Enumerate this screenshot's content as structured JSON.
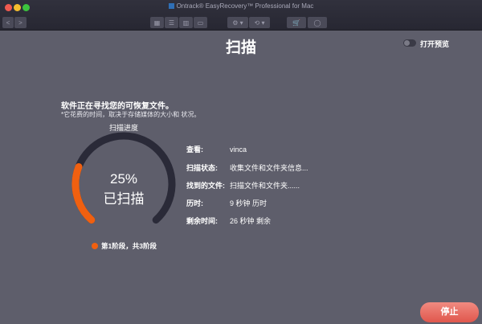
{
  "window": {
    "title": "Ontrack® EasyRecovery™ Professional for Mac"
  },
  "toolbar": {
    "back": "<",
    "forward": ">",
    "views": [
      "▦",
      "☰",
      "▥",
      "▭"
    ],
    "settings": "⚙ ▾",
    "history": "⟲ ▾",
    "cart": "🛒",
    "account": "◯"
  },
  "page": {
    "title": "扫描",
    "preview_toggle_label": "打开预览",
    "preview_on": false
  },
  "message": {
    "title": "软件正在寻找您的可恢复文件。",
    "note": "*它花费的时间，取决于存储媒体的大小和 状况。"
  },
  "progress": {
    "label": "扫描进度",
    "percent": 25,
    "percent_text": "25%",
    "scanned_label": "已扫描",
    "stage_text": "第1阶段，共3阶段"
  },
  "details": [
    {
      "key": "查看:",
      "value": "vinca"
    },
    {
      "key": "扫描状态:",
      "value": "收集文件和文件夹信息..."
    },
    {
      "key": "找到的文件:",
      "value": "扫描文件和文件夹......"
    },
    {
      "key": "历时:",
      "value": "9 秒钟 历时"
    },
    {
      "key": "剩余时间:",
      "value": "26 秒钟 剩余"
    }
  ],
  "buttons": {
    "stop": "停止"
  },
  "colors": {
    "accent": "#f06010",
    "track": "#2a2a38",
    "background": "#5e5e6b"
  }
}
